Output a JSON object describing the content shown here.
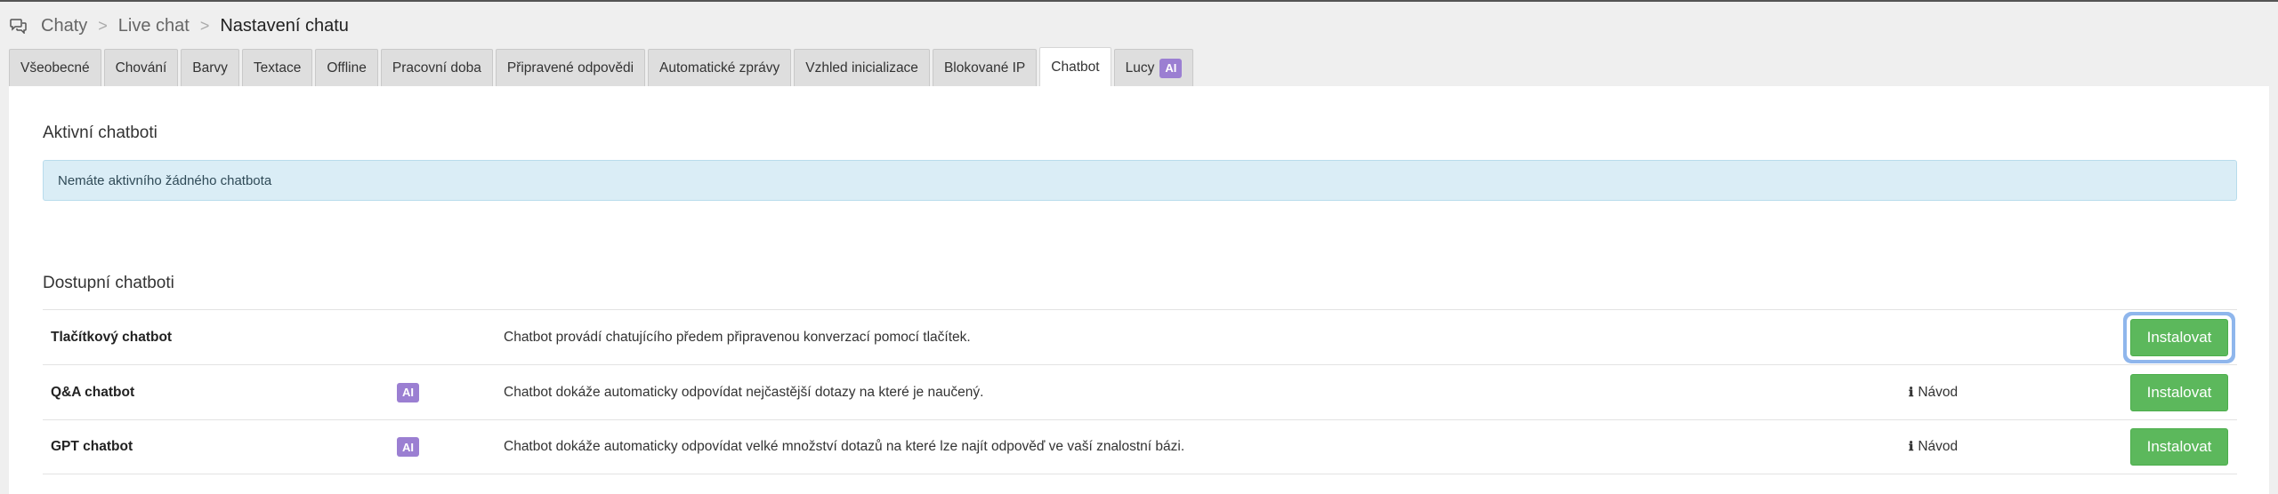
{
  "breadcrumb": {
    "icon": "chat-bubbles-icon",
    "items": [
      "Chaty",
      "Live chat"
    ],
    "separator": ">",
    "current": "Nastavení chatu"
  },
  "tabs": [
    {
      "label": "Všeobecné"
    },
    {
      "label": "Chování"
    },
    {
      "label": "Barvy"
    },
    {
      "label": "Textace"
    },
    {
      "label": "Offline"
    },
    {
      "label": "Pracovní doba"
    },
    {
      "label": "Připravené odpovědi"
    },
    {
      "label": "Automatické zprávy"
    },
    {
      "label": "Vzhled inicializace"
    },
    {
      "label": "Blokované IP"
    },
    {
      "label": "Chatbot",
      "active": true
    },
    {
      "label": "Lucy",
      "badge": "AI"
    }
  ],
  "active_section": {
    "title": "Aktivní chatboti",
    "empty_message": "Nemáte aktivního žádného chatbota"
  },
  "available_section": {
    "title": "Dostupní chatboti",
    "rows": [
      {
        "name": "Tlačítkový chatbot",
        "badge": "",
        "description": "Chatbot provádí chatujícího předem připravenou konverzací pomocí tlačítek.",
        "guide": "",
        "action": "Instalovat"
      },
      {
        "name": "Q&A chatbot",
        "badge": "AI",
        "description": "Chatbot dokáže automaticky odpovídat nejčastější dotazy na které je naučený.",
        "guide": "Návod",
        "action": "Instalovat"
      },
      {
        "name": "GPT chatbot",
        "badge": "AI",
        "description": "Chatbot dokáže automaticky odpovídat velké množství dotazů na které lze najít odpověď ve vaší znalostní bázi.",
        "guide": "Návod",
        "action": "Instalovat"
      }
    ]
  },
  "colors": {
    "accent_ai": "#9b7fd2",
    "install_button": "#5cb85c",
    "info_box": "#daedf6"
  }
}
